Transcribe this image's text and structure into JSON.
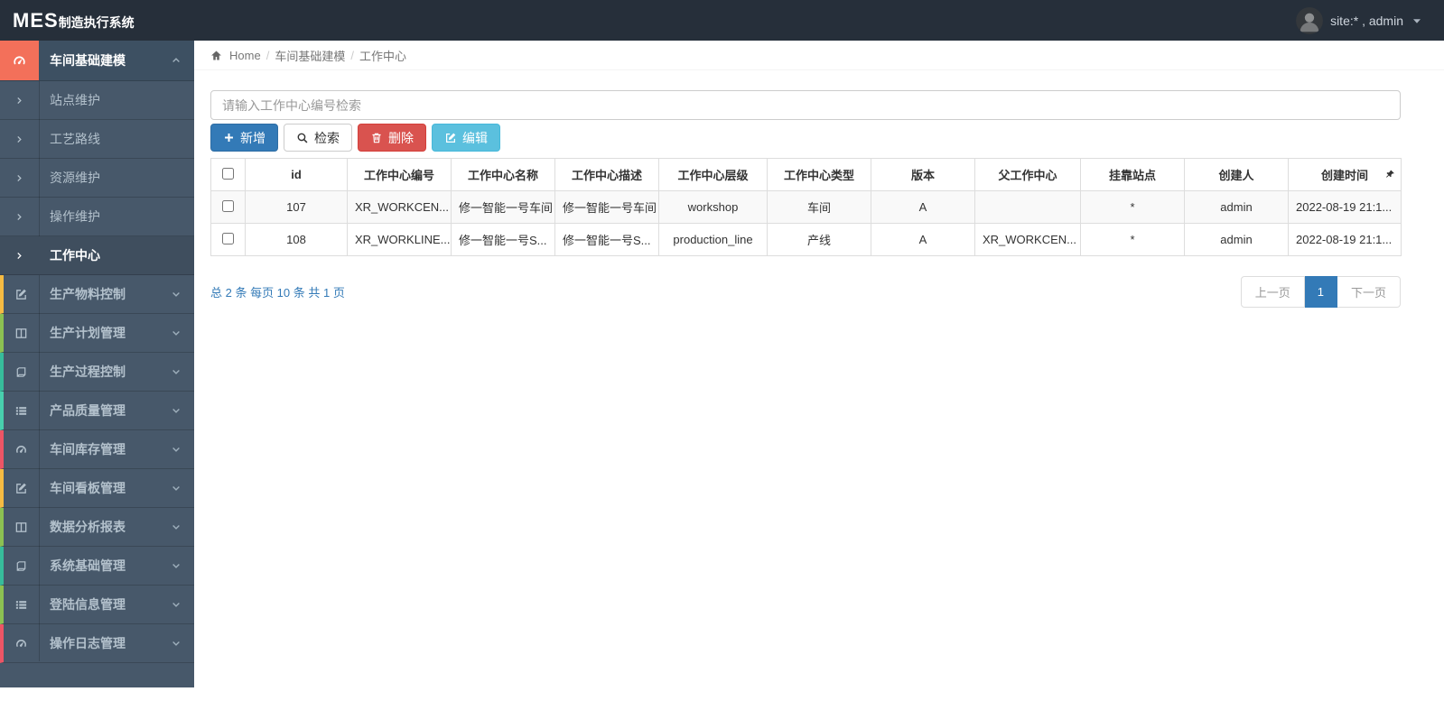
{
  "navbar": {
    "brand_mes": "MES",
    "brand_suffix": "制造执行系统",
    "user_label": "site:* , admin"
  },
  "breadcrumb": {
    "home": "Home",
    "level1": "车间基础建模",
    "level2": "工作中心"
  },
  "sidebar": {
    "active_group": {
      "label": "车间基础建模",
      "icon": "tachometer-icon"
    },
    "submenu": [
      {
        "label": "站点维护",
        "active": false
      },
      {
        "label": "工艺路线",
        "active": false
      },
      {
        "label": "资源维护",
        "active": false
      },
      {
        "label": "操作维护",
        "active": false
      },
      {
        "label": "工作中心",
        "active": true
      }
    ],
    "groups": [
      {
        "label": "生产物料控制",
        "icon": "pencil-square-icon",
        "accent": "#f6bb42"
      },
      {
        "label": "生产计划管理",
        "icon": "columns-icon",
        "accent": "#8cc152"
      },
      {
        "label": "生产过程控制",
        "icon": "book-icon",
        "accent": "#37bc9b"
      },
      {
        "label": "产品质量管理",
        "icon": "list-icon",
        "accent": "#48cfad"
      },
      {
        "label": "车间库存管理",
        "icon": "tachometer-icon",
        "accent": "#ed5565"
      },
      {
        "label": "车间看板管理",
        "icon": "pencil-square-icon",
        "accent": "#f6bb42"
      },
      {
        "label": "数据分析报表",
        "icon": "columns-icon",
        "accent": "#8cc152"
      },
      {
        "label": "系统基础管理",
        "icon": "book-icon",
        "accent": "#37bc9b"
      },
      {
        "label": "登陆信息管理",
        "icon": "list-icon",
        "accent": "#8cc152"
      },
      {
        "label": "操作日志管理",
        "icon": "tachometer-icon",
        "accent": "#ed5565"
      }
    ]
  },
  "search": {
    "placeholder": "请输入工作中心编号检索",
    "value": ""
  },
  "toolbar": {
    "add_label": "新增",
    "search_label": "检索",
    "delete_label": "删除",
    "edit_label": "编辑"
  },
  "table": {
    "headers": [
      "id",
      "工作中心编号",
      "工作中心名称",
      "工作中心描述",
      "工作中心层级",
      "工作中心类型",
      "版本",
      "父工作中心",
      "挂靠站点",
      "创建人",
      "创建时间"
    ],
    "rows": [
      [
        "107",
        "XR_WORKCEN...",
        "修一智能一号车间",
        "修一智能一号车间",
        "workshop",
        "车间",
        "A",
        "",
        "*",
        "admin",
        "2022-08-19 21:1..."
      ],
      [
        "108",
        "XR_WORKLINE...",
        "修一智能一号S...",
        "修一智能一号S...",
        "production_line",
        "产线",
        "A",
        "XR_WORKCEN...",
        "*",
        "admin",
        "2022-08-19 21:1..."
      ]
    ]
  },
  "pagination": {
    "summary": "总 2 条 每页 10 条 共 1 页",
    "prev_label": "上一页",
    "current_page": "1",
    "next_label": "下一页"
  },
  "colors": {
    "navbar_bg": "#262f3a",
    "sidebar_bg": "#47586a",
    "active_group_icon_bg": "#f3705a",
    "primary": "#337ab7",
    "danger": "#d9534f",
    "info": "#5bc0de",
    "pagination_active": "#337ab7"
  }
}
